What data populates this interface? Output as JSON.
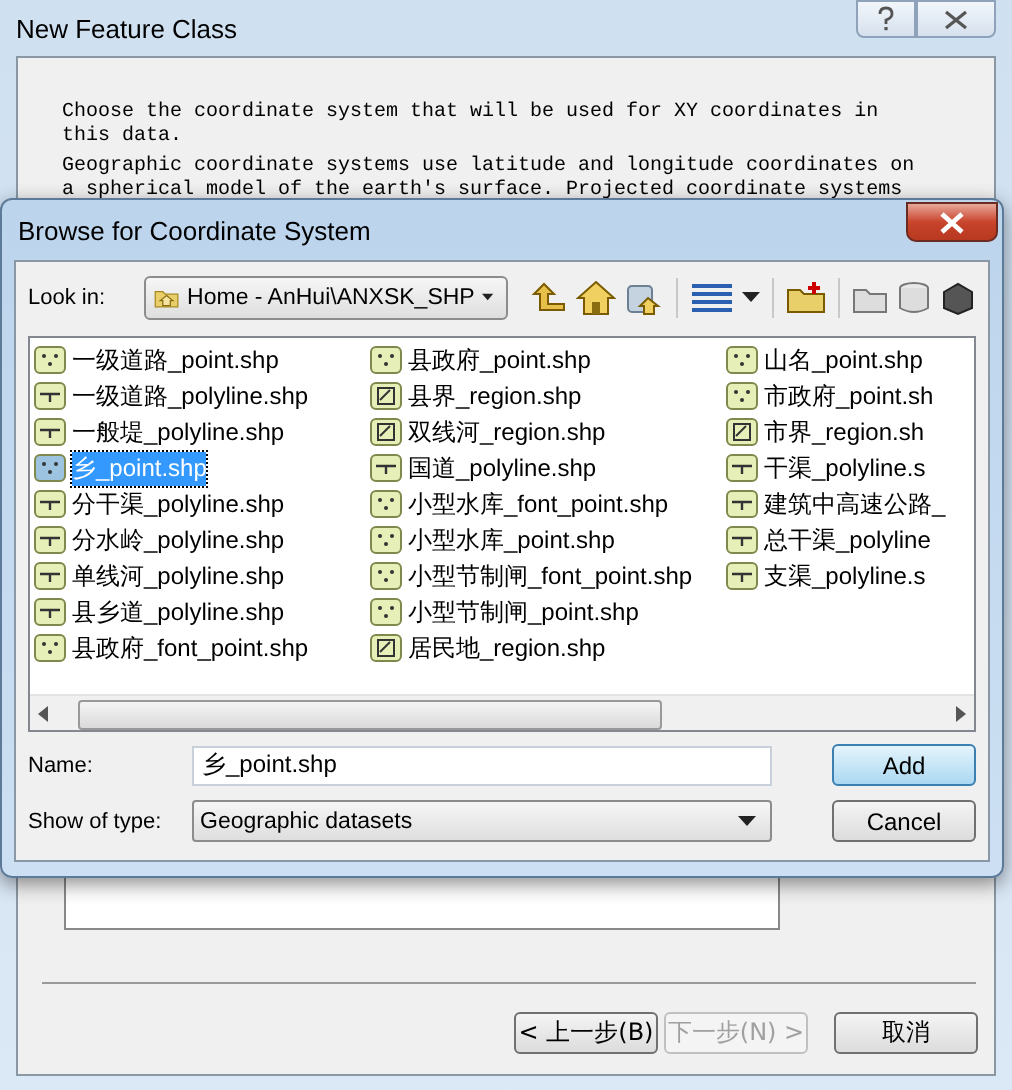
{
  "window": {
    "title": "New Feature Class"
  },
  "intro": [
    "Choose the coordinate system that will be used for XY coordinates in this data.",
    "Geographic coordinate systems use latitude and longitude coordinates on a spherical model of the earth's surface. Projected coordinate systems"
  ],
  "dialog": {
    "title": "Browse for Coordinate System",
    "look_in_label": "Look in:",
    "look_in": "Home - AnHui\\ANXSK_SHP",
    "files": [
      {
        "name": "一级道路_point.shp",
        "kind": "point",
        "selected": false
      },
      {
        "name": "一级道路_polyline.shp",
        "kind": "polyline",
        "selected": false
      },
      {
        "name": "一般堤_polyline.shp",
        "kind": "polyline",
        "selected": false
      },
      {
        "name": "乡_point.shp",
        "kind": "point",
        "selected": true
      },
      {
        "name": "分干渠_polyline.shp",
        "kind": "polyline",
        "selected": false
      },
      {
        "name": "分水岭_polyline.shp",
        "kind": "polyline",
        "selected": false
      },
      {
        "name": "单线河_polyline.shp",
        "kind": "polyline",
        "selected": false
      },
      {
        "name": "县乡道_polyline.shp",
        "kind": "polyline",
        "selected": false
      },
      {
        "name": "县政府_font_point.shp",
        "kind": "point",
        "selected": false
      },
      {
        "name": "县政府_point.shp",
        "kind": "point",
        "selected": false
      },
      {
        "name": "县界_region.shp",
        "kind": "region",
        "selected": false
      },
      {
        "name": "双线河_region.shp",
        "kind": "region",
        "selected": false
      },
      {
        "name": "国道_polyline.shp",
        "kind": "polyline",
        "selected": false
      },
      {
        "name": "小型水库_font_point.shp",
        "kind": "point",
        "selected": false
      },
      {
        "name": "小型水库_point.shp",
        "kind": "point",
        "selected": false
      },
      {
        "name": "小型节制闸_font_point.shp",
        "kind": "point",
        "selected": false
      },
      {
        "name": "小型节制闸_point.shp",
        "kind": "point",
        "selected": false
      },
      {
        "name": "居民地_region.shp",
        "kind": "region",
        "selected": false
      },
      {
        "name": "山名_point.shp",
        "kind": "point",
        "selected": false
      },
      {
        "name": "市政府_point.sh",
        "kind": "point",
        "selected": false
      },
      {
        "name": "市界_region.sh",
        "kind": "region",
        "selected": false
      },
      {
        "name": "干渠_polyline.s",
        "kind": "polyline",
        "selected": false
      },
      {
        "name": "建筑中高速公路_",
        "kind": "polyline",
        "selected": false
      },
      {
        "name": "总干渠_polyline",
        "kind": "polyline",
        "selected": false
      },
      {
        "name": "支渠_polyline.s",
        "kind": "polyline",
        "selected": false
      }
    ],
    "name_label": "Name:",
    "name": "乡_point.shp",
    "type_label": "Show of type:",
    "type": "Geographic datasets",
    "buttons": [
      {
        "label": "Add",
        "kind": "default"
      },
      {
        "label": "Cancel",
        "kind": "normal"
      }
    ]
  },
  "wizard_buttons": [
    {
      "label": "< 上一步(B)",
      "disabled": false
    },
    {
      "label": "下一步(N) >",
      "disabled": true
    },
    {
      "label": "取消",
      "disabled": false
    }
  ]
}
